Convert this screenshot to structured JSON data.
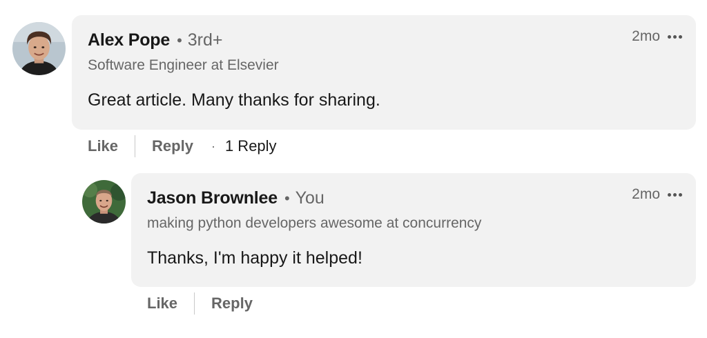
{
  "comments": [
    {
      "author": "Alex Pope",
      "degree": "3rd+",
      "headline": "Software Engineer at Elsevier",
      "time": "2mo",
      "text": "Great article. Many thanks for sharing.",
      "like_label": "Like",
      "reply_label": "Reply",
      "reply_count": "1 Reply"
    },
    {
      "author": "Jason Brownlee",
      "degree": "You",
      "headline": "making python developers awesome at concurrency",
      "time": "2mo",
      "text": "Thanks, I'm happy it helped!",
      "like_label": "Like",
      "reply_label": "Reply"
    }
  ],
  "icons": {
    "more": "more-options-icon"
  },
  "colors": {
    "bubble": "#f2f2f2",
    "secondary_text": "#666666"
  }
}
